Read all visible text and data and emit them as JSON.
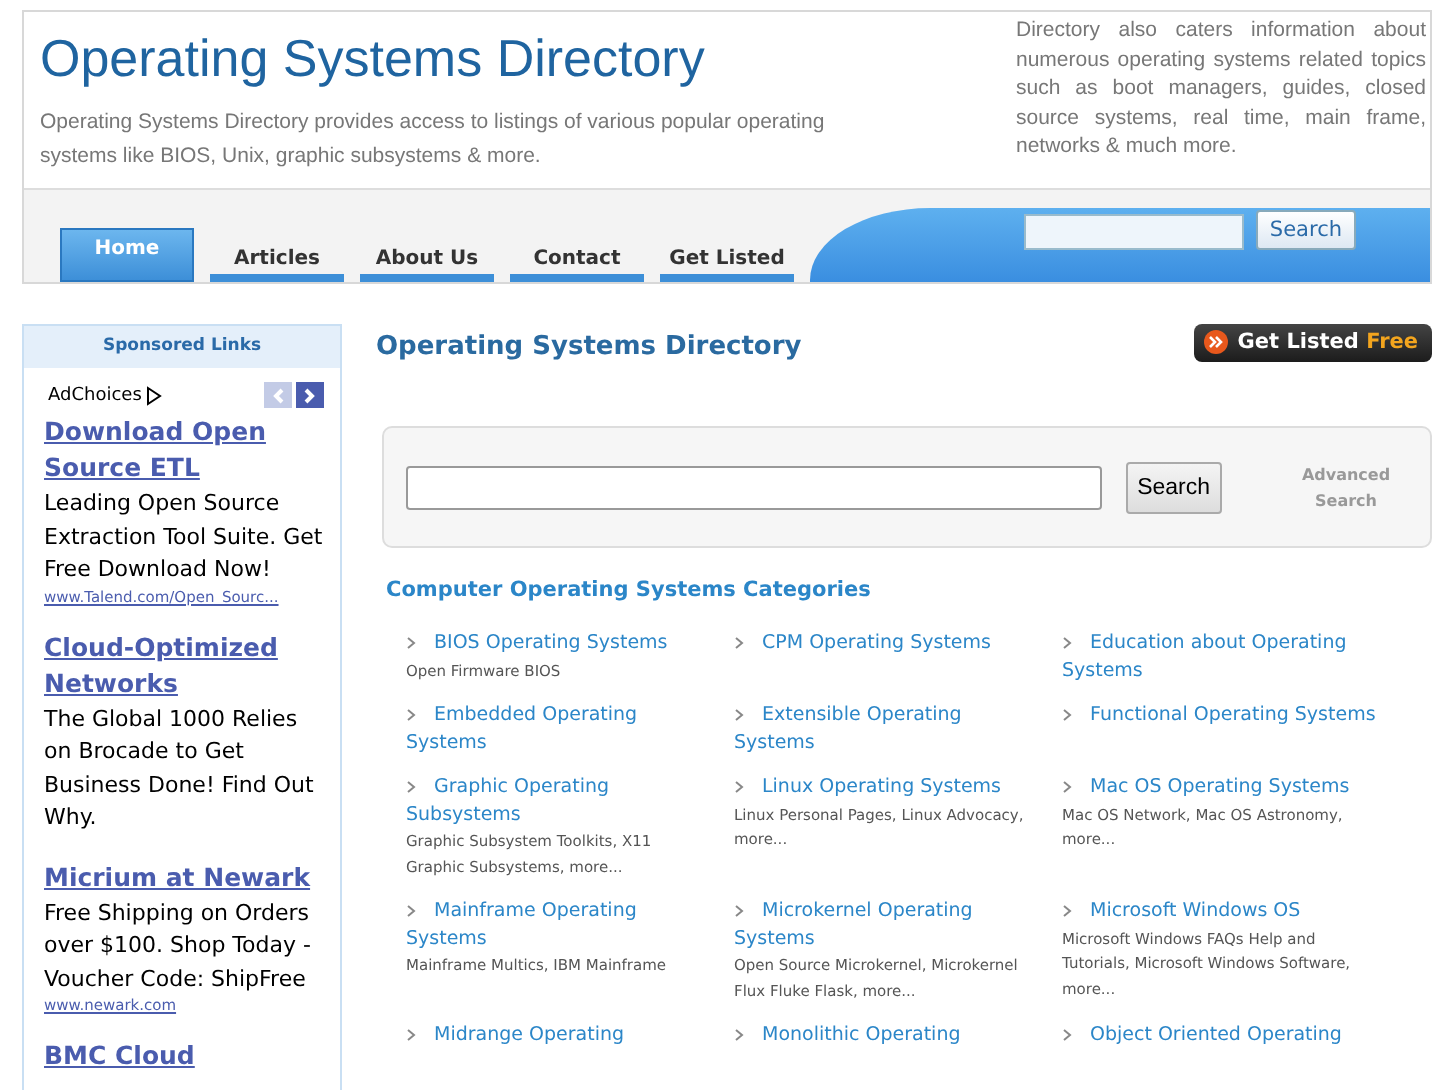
{
  "header": {
    "title": "Operating Systems Directory",
    "tagline": "Operating Systems Directory provides access to listings of various popular operating systems like BIOS, Unix, graphic subsystems & more.",
    "blurb": "Directory also caters information about numerous operating systems related topics such as boot managers, guides, closed source systems, real time, main frame, networks & much more."
  },
  "nav": [
    {
      "label": "Home",
      "selected": true
    },
    {
      "label": "Articles",
      "selected": false
    },
    {
      "label": "About Us",
      "selected": false
    },
    {
      "label": "Contact",
      "selected": false
    },
    {
      "label": "Get Listed",
      "selected": false
    }
  ],
  "header_search": {
    "button": "Search"
  },
  "sidebar": {
    "title": "Sponsored Links",
    "adchoices": "AdChoices",
    "ads": [
      {
        "title": "Download Open Source ETL",
        "text": "Leading Open Source Extraction Tool Suite. Get Free Download Now!",
        "url": "www.Talend.com/Open_Sourc..."
      },
      {
        "title": "Cloud-Optimized Networks",
        "text": "The Global 1000 Relies on Brocade to Get Business Done! Find Out Why."
      },
      {
        "title": "Micrium at Newark",
        "text": "Free Shipping on Orders over $100. Shop Today - Voucher Code: ShipFree",
        "url": "www.newark.com"
      },
      {
        "title": "BMC Cloud"
      }
    ]
  },
  "main": {
    "title": "Operating Systems Directory",
    "get_listed": {
      "label": "Get Listed",
      "accent": "Free"
    },
    "search": {
      "button": "Search",
      "advanced": "Advanced Search"
    },
    "categories_title": "Computer Operating Systems Categories",
    "categories": [
      {
        "name": "BIOS Operating Systems",
        "description": "Open Firmware BIOS"
      },
      {
        "name": "CPM Operating Systems"
      },
      {
        "name": "Education about Operating Systems"
      },
      {
        "name": "Embedded Operating Systems"
      },
      {
        "name": "Extensible Operating Systems"
      },
      {
        "name": "Functional Operating Systems"
      },
      {
        "name": "Graphic Operating Subsystems",
        "description": "Graphic Subsystem Toolkits, X11 Graphic Subsystems, more..."
      },
      {
        "name": "Linux Operating Systems",
        "description": "Linux Personal Pages, Linux Advocacy, more..."
      },
      {
        "name": "Mac OS Operating Systems",
        "description": "Mac OS Network, Mac OS Astronomy, more..."
      },
      {
        "name": "Mainframe Operating Systems",
        "description": "Mainframe Multics, IBM Mainframe"
      },
      {
        "name": "Microkernel Operating Systems",
        "description": "Open Source Microkernel, Microkernel Flux Fluke Flask, more..."
      },
      {
        "name": "Microsoft Windows OS",
        "description": "Microsoft Windows FAQs Help and Tutorials, Microsoft Windows Software, more..."
      },
      {
        "name": "Midrange Operating"
      },
      {
        "name": "Monolithic Operating"
      },
      {
        "name": "Object Oriented Operating"
      }
    ]
  }
}
